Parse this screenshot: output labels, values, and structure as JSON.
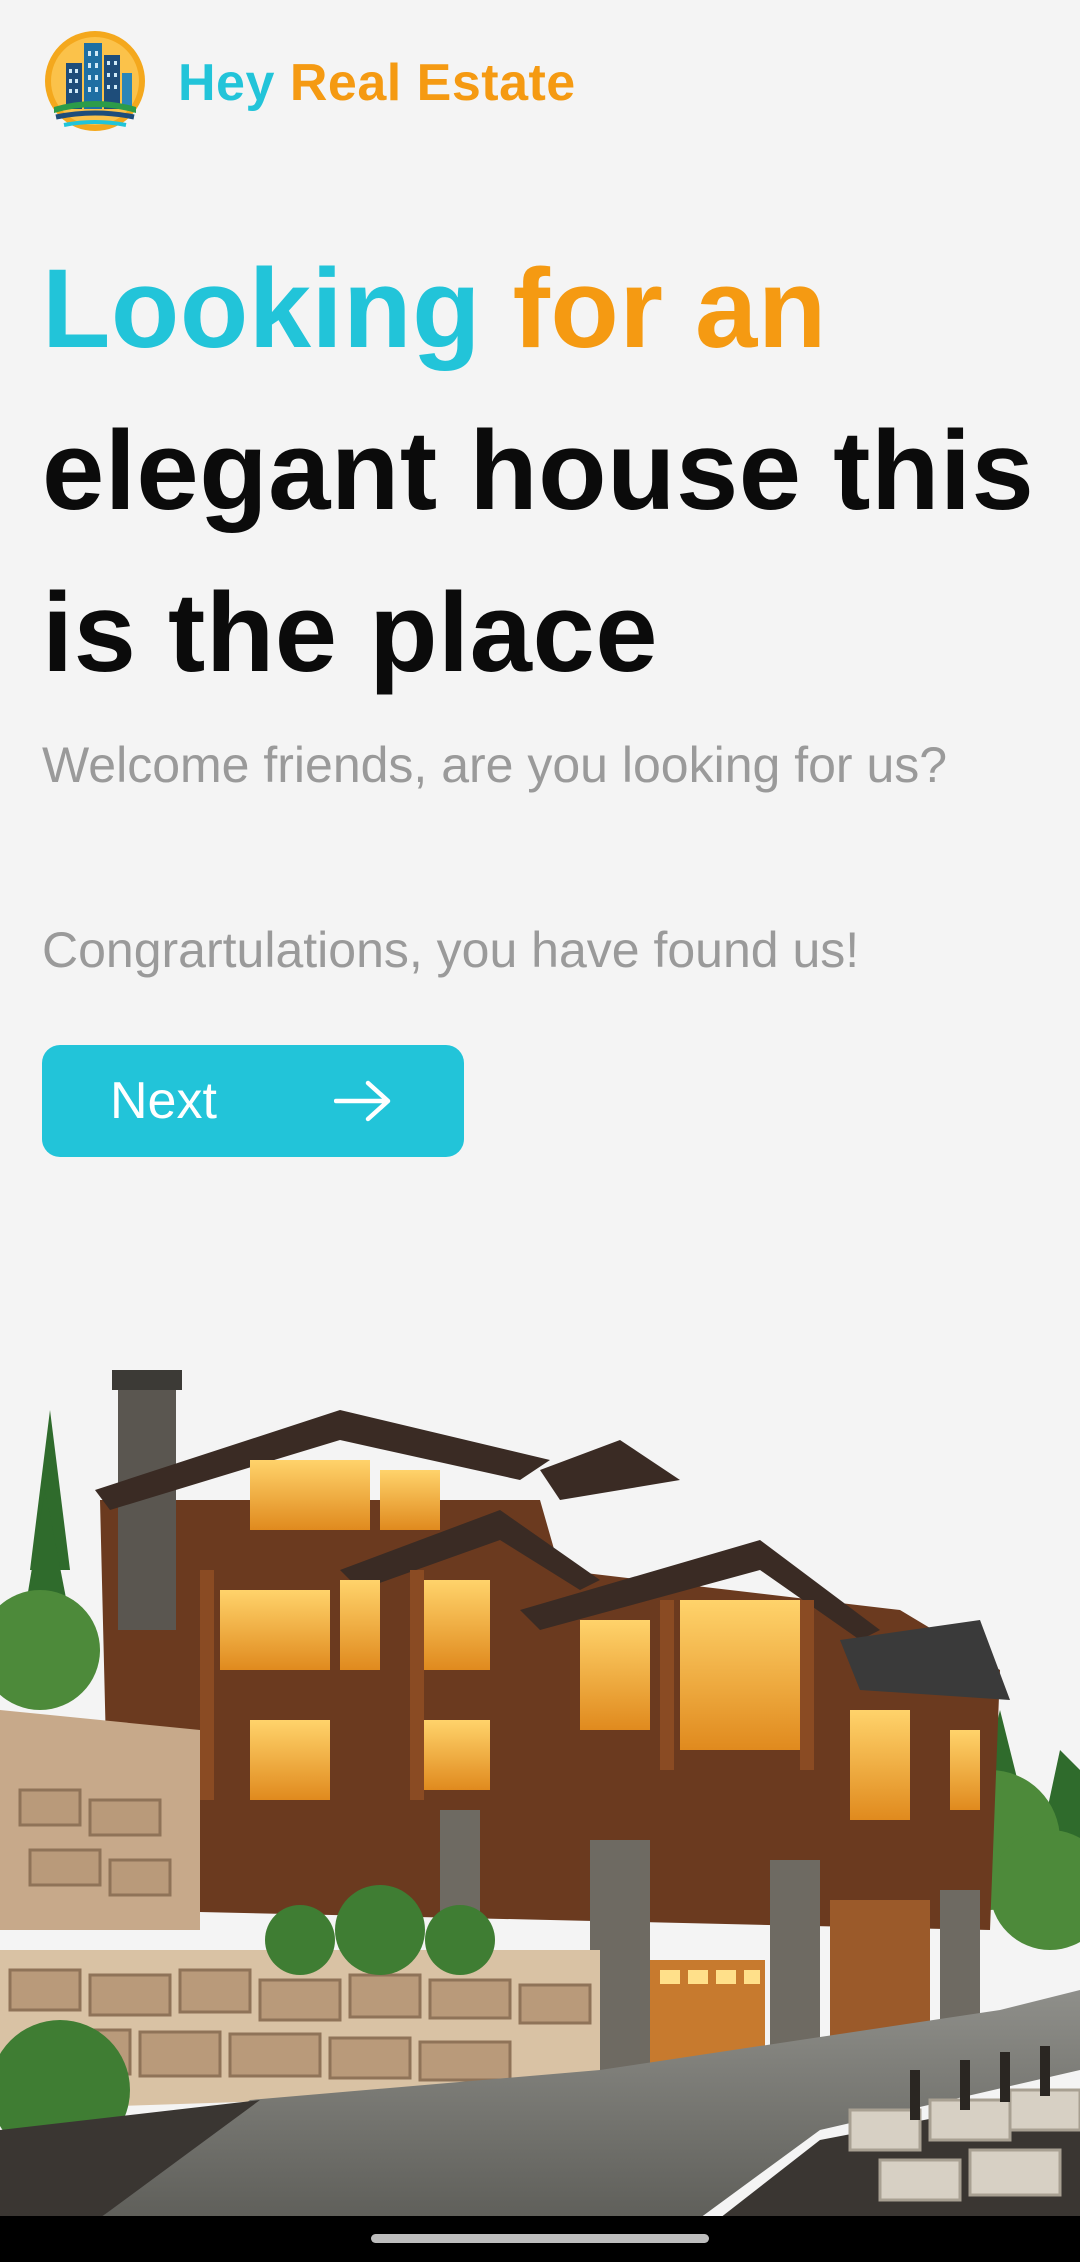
{
  "colors": {
    "accent_cyan": "#22c4d9",
    "accent_orange": "#f59a12",
    "background": "#f4f4f4"
  },
  "brand": {
    "logo_icon": "city-buildings-logo",
    "name_part1": "Hey",
    "name_part2": "Real Estate"
  },
  "headline": {
    "word1": "Looking",
    "word2": "for an",
    "rest": "elegant house this is the place"
  },
  "subtitle": "Welcome friends, are you looking for us?",
  "subtitle2": "Congrartulations, you have found us!",
  "next_button": {
    "label": "Next",
    "icon": "arrow-right-icon"
  },
  "hero_image": {
    "subject": "luxury-mountain-house"
  }
}
